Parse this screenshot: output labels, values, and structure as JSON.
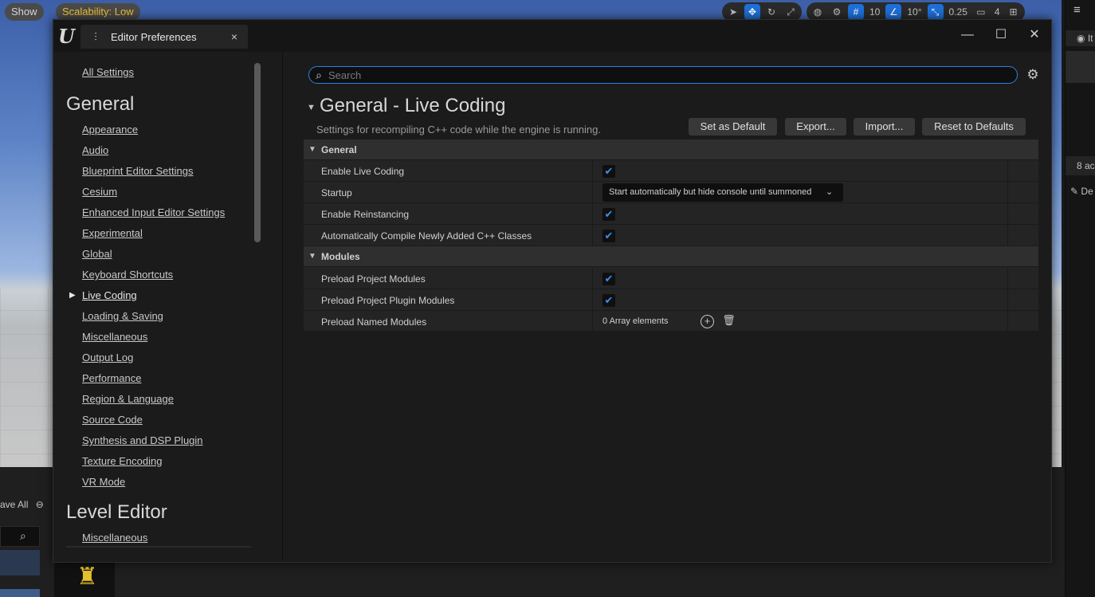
{
  "background": {
    "show_button": "Show",
    "scalability": "Scalability: Low",
    "toolbar": {
      "grid_snap": "10",
      "rotation_snap": "10°",
      "scale_snap": "0.25",
      "camera_speed": "4"
    },
    "save_all": "ave All",
    "right_panel": {
      "item_label": "It",
      "count_label": "8 ac",
      "details_label": "De"
    }
  },
  "dialog": {
    "tab_title": "Editor Preferences",
    "tab_close": "×",
    "window_buttons": {
      "minimize": "—",
      "maximize": "☐",
      "close": "✕"
    }
  },
  "nav": {
    "all_settings": "All Settings",
    "sections": [
      {
        "title": "General",
        "items": [
          "Appearance",
          "Audio",
          "Blueprint Editor Settings",
          "Cesium",
          "Enhanced Input Editor Settings",
          "Experimental",
          "Global",
          "Keyboard Shortcuts",
          "Live Coding",
          "Loading & Saving",
          "Miscellaneous",
          "Output Log",
          "Performance",
          "Region & Language",
          "Source Code",
          "Synthesis and DSP Plugin",
          "Texture Encoding",
          "VR Mode"
        ],
        "selected": "Live Coding"
      },
      {
        "title": "Level Editor",
        "items": [
          "Miscellaneous"
        ]
      }
    ]
  },
  "content": {
    "search_placeholder": "Search",
    "title": "General - Live Coding",
    "description": "Settings for recompiling C++ code while the engine is running.",
    "buttons": {
      "set_default": "Set as Default",
      "export": "Export...",
      "import": "Import...",
      "reset": "Reset to Defaults"
    },
    "categories": [
      {
        "name": "General",
        "properties": [
          {
            "label": "Enable Live Coding",
            "type": "checkbox",
            "checked": true
          },
          {
            "label": "Startup",
            "type": "dropdown",
            "value": "Start automatically but hide console until summoned"
          },
          {
            "label": "Enable Reinstancing",
            "type": "checkbox",
            "checked": true
          },
          {
            "label": "Automatically Compile Newly Added C++ Classes",
            "type": "checkbox",
            "checked": true
          }
        ]
      },
      {
        "name": "Modules",
        "properties": [
          {
            "label": "Preload Project Modules",
            "type": "checkbox",
            "checked": true
          },
          {
            "label": "Preload Project Plugin Modules",
            "type": "checkbox",
            "checked": true
          },
          {
            "label": "Preload Named Modules",
            "type": "array",
            "value": "0 Array elements"
          }
        ]
      }
    ]
  },
  "colors": {
    "accent": "#2f7fe0",
    "checkmark": "#3b8df0",
    "panel": "#1b1b1b",
    "row": "#242424"
  }
}
